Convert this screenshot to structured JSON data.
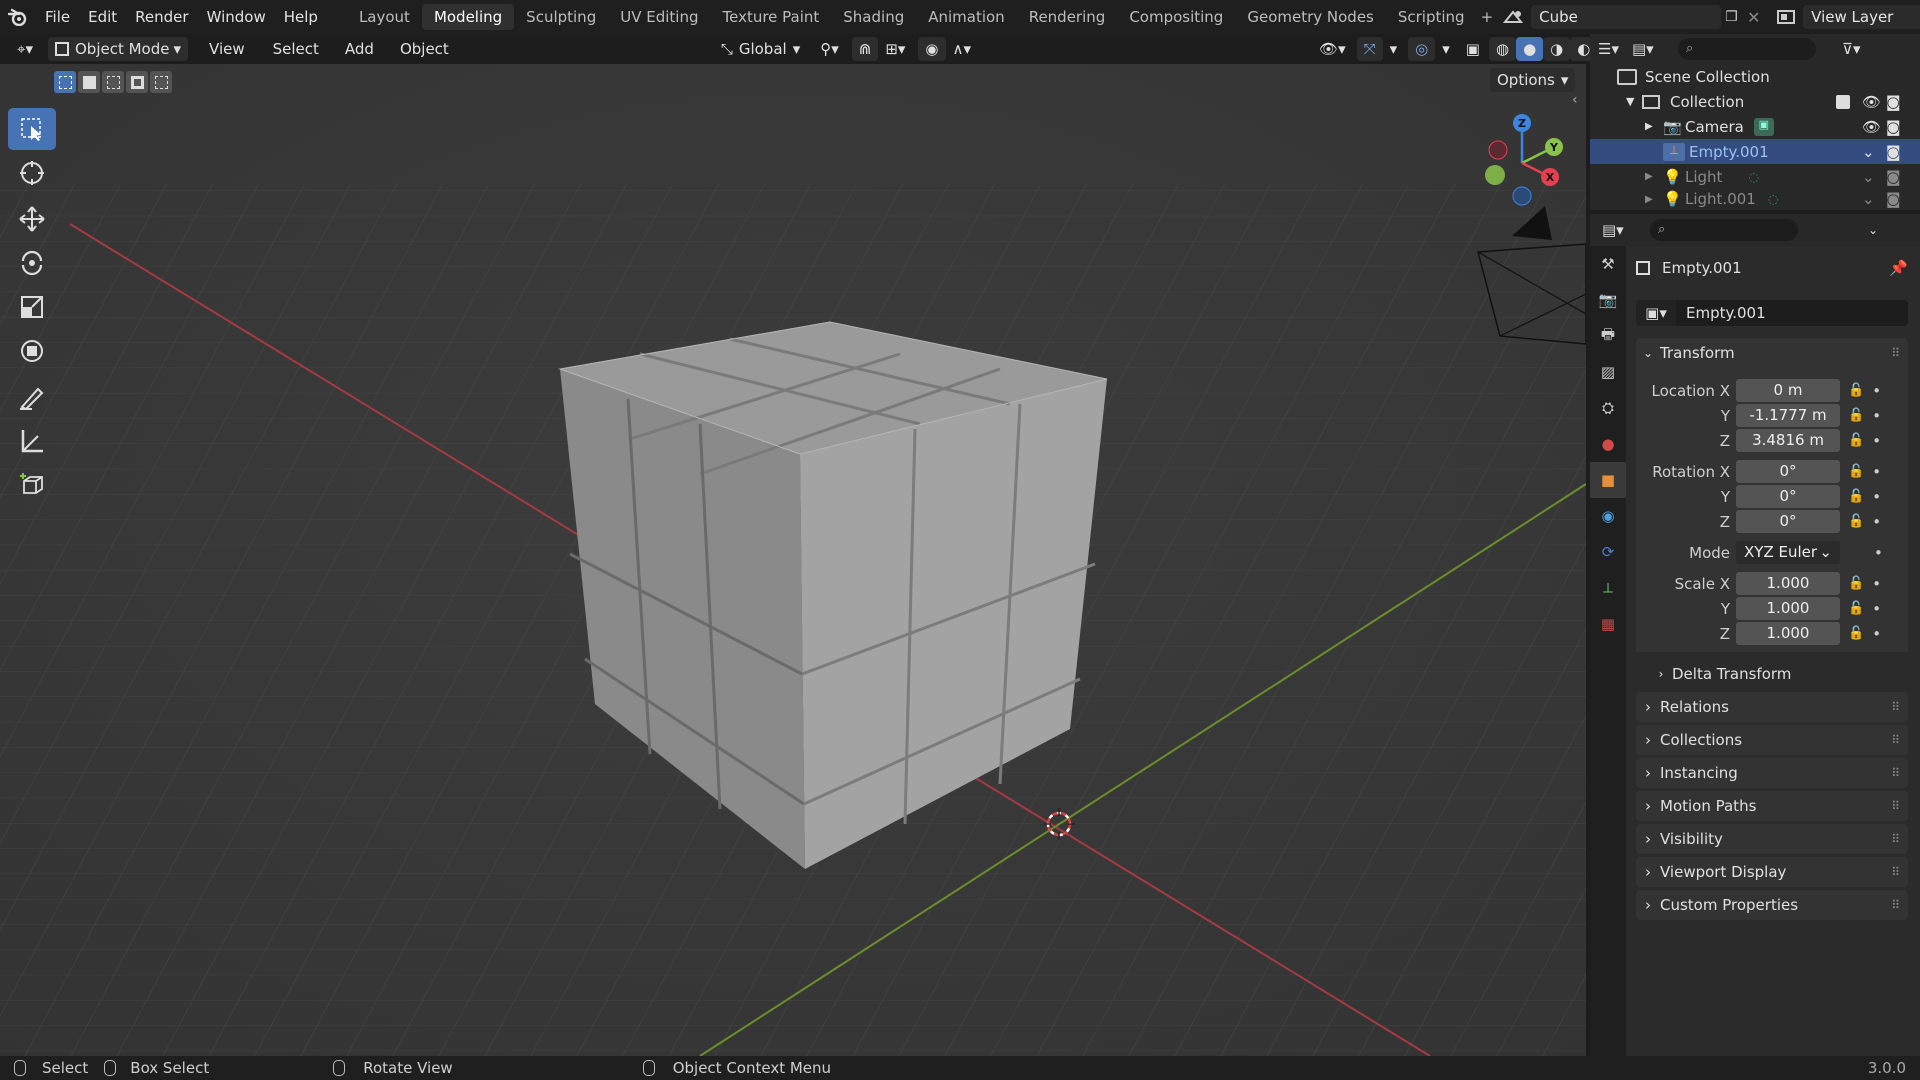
{
  "menu": [
    "File",
    "Edit",
    "Render",
    "Window",
    "Help"
  ],
  "workspaces": [
    "Layout",
    "Modeling",
    "Sculpting",
    "UV Editing",
    "Texture Paint",
    "Shading",
    "Animation",
    "Rendering",
    "Compositing",
    "Geometry Nodes",
    "Scripting"
  ],
  "active_workspace": "Modeling",
  "scene_name": "Cube",
  "view_layer": "View Layer",
  "header": {
    "mode": "Object Mode",
    "view": "View",
    "select": "Select",
    "add": "Add",
    "object": "Object",
    "orientation": "Global",
    "options": "Options"
  },
  "gizmo": {
    "x": "X",
    "y": "Y",
    "z": "Z"
  },
  "outliner": {
    "scene_collection": "Scene Collection",
    "collection": "Collection",
    "items": [
      {
        "label": "Camera"
      },
      {
        "label": "Empty.001"
      },
      {
        "label": "Light"
      },
      {
        "label": "Light.001"
      }
    ]
  },
  "properties": {
    "object_name": "Empty.001",
    "datablock_name": "Empty.001",
    "transform": "Transform",
    "location_label": "Location X",
    "location": {
      "x": "0 m",
      "y": "-1.1777 m",
      "z": "3.4816 m"
    },
    "rotation_label": "Rotation X",
    "rotation": {
      "x": "0°",
      "y": "0°",
      "z": "0°"
    },
    "mode_label": "Mode",
    "mode": "XYZ Euler",
    "scale_label": "Scale X",
    "scale": {
      "x": "1.000",
      "y": "1.000",
      "z": "1.000"
    },
    "axis_y": "Y",
    "axis_z": "Z",
    "delta": "Delta Transform",
    "panels": [
      "Relations",
      "Collections",
      "Instancing",
      "Motion Paths",
      "Visibility",
      "Viewport Display",
      "Custom Properties"
    ]
  },
  "status": {
    "select": "Select",
    "box_select": "Box Select",
    "rotate": "Rotate View",
    "context": "Object Context Menu",
    "version": "3.0.0"
  },
  "colors": {
    "accent": "#4772b3",
    "selection": "#334d80",
    "x_axis": "#e4404f",
    "y_axis": "#8bc34a",
    "z_axis": "#3b86e0"
  }
}
